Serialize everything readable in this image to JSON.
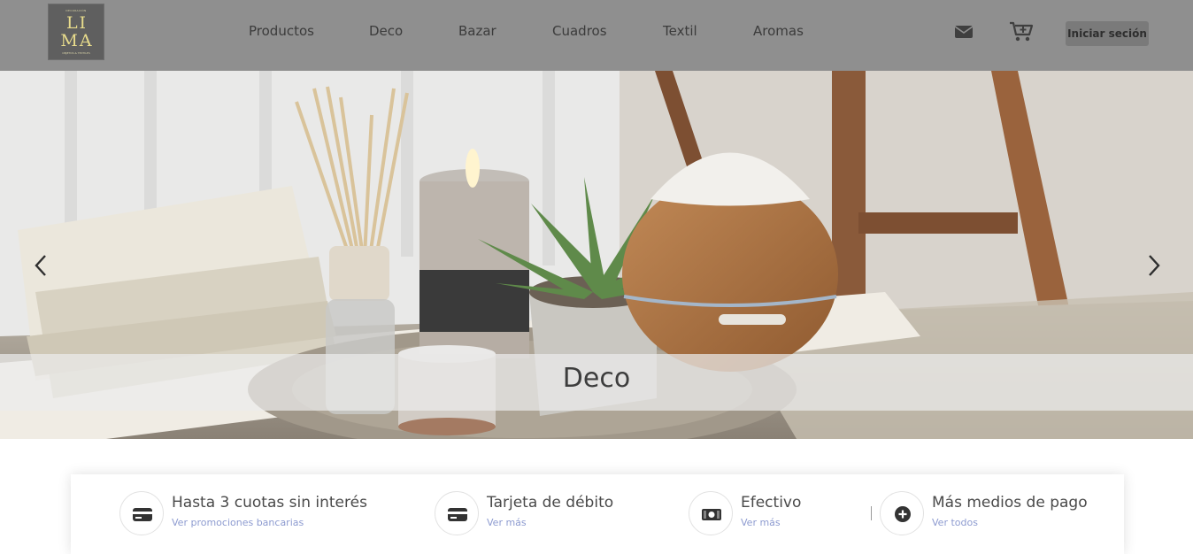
{
  "brand": {
    "logo_top": "DECORACIÓN",
    "logo_line1": "LI",
    "logo_line2": "MA",
    "logo_bottom": "OBJETOS & TEXTILES"
  },
  "nav": {
    "items": [
      {
        "label": "Productos"
      },
      {
        "label": "Deco"
      },
      {
        "label": "Bazar"
      },
      {
        "label": "Cuadros"
      },
      {
        "label": "Textil"
      },
      {
        "label": "Aromas"
      }
    ]
  },
  "header": {
    "mail_icon": "envelope-icon",
    "cart_icon": "cart-plus-icon",
    "login_label": "Iniciar seción"
  },
  "hero": {
    "caption": "Deco",
    "prev_icon": "chevron-left-icon",
    "next_icon": "chevron-right-icon"
  },
  "payments": [
    {
      "title": "Hasta 3 cuotas sin interés",
      "link": "Ver promociones bancarias",
      "icon": "credit-card-icon"
    },
    {
      "title": "Tarjeta de débito",
      "link": "Ver más",
      "icon": "debit-card-icon"
    },
    {
      "title": "Efectivo",
      "link": "Ver más",
      "icon": "cash-icon"
    },
    {
      "title": "Más medios de pago",
      "link": "Ver todos",
      "icon": "plus-circle-icon"
    }
  ],
  "colors": {
    "header_bg": "#8f8f8f",
    "link_accent": "#8d9bd0",
    "logo_gold": "#e8dc8c"
  }
}
